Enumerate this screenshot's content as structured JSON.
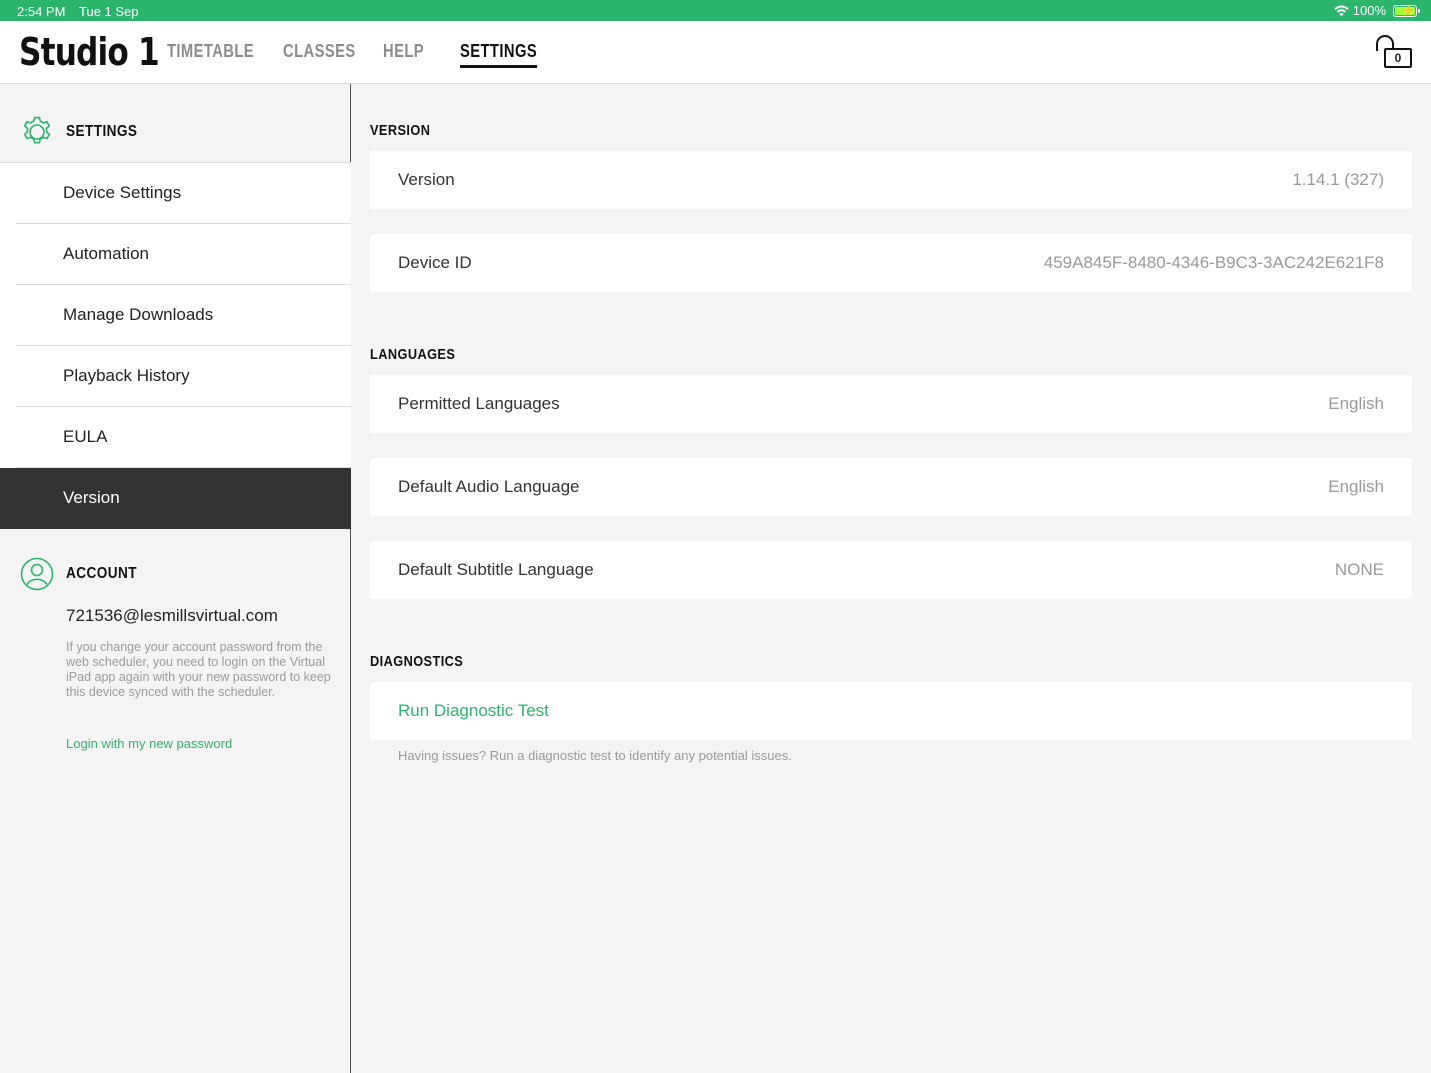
{
  "status_bar": {
    "time": "2:54 PM",
    "date": "Tue 1 Sep",
    "battery": "100%"
  },
  "nav": {
    "brand": "Studio 1",
    "tabs": [
      "TIMETABLE",
      "CLASSES",
      "HELP",
      "SETTINGS"
    ],
    "active_tab": "SETTINGS",
    "lock_count": "0"
  },
  "sidebar": {
    "settings_title": "SETTINGS",
    "items": [
      {
        "label": "Device Settings"
      },
      {
        "label": "Automation"
      },
      {
        "label": "Manage Downloads"
      },
      {
        "label": "Playback History"
      },
      {
        "label": "EULA"
      },
      {
        "label": "Version"
      }
    ],
    "active_item": "Version",
    "account_title": "ACCOUNT",
    "account_email": "721536@lesmillsvirtual.com",
    "account_note": "If you change your account password from the web scheduler, you need to login on the Virtual iPad app again with your new password to keep this device synced with the scheduler.",
    "login_link": "Login with my new password"
  },
  "main": {
    "version_title": "VERSION",
    "version_rows": [
      {
        "key": "Version",
        "value": "1.14.1 (327)"
      },
      {
        "key": "Device ID",
        "value": "459A845F-8480-4346-B9C3-3AC242E621F8"
      }
    ],
    "languages_title": "LANGUAGES",
    "language_rows": [
      {
        "key": "Permitted Languages",
        "value": "English"
      },
      {
        "key": "Default Audio Language",
        "value": "English"
      },
      {
        "key": "Default Subtitle Language",
        "value": "NONE"
      }
    ],
    "diagnostics_title": "DIAGNOSTICS",
    "diagnostic_action": "Run Diagnostic Test",
    "diagnostic_hint": "Having issues? Run a diagnostic test to identify any potential issues."
  },
  "colors": {
    "accent": "#2bb46c",
    "active_item_bg": "#333333"
  },
  "icons": [
    "wifi-icon",
    "battery-icon",
    "lock-icon",
    "gear-icon",
    "user-icon"
  ]
}
